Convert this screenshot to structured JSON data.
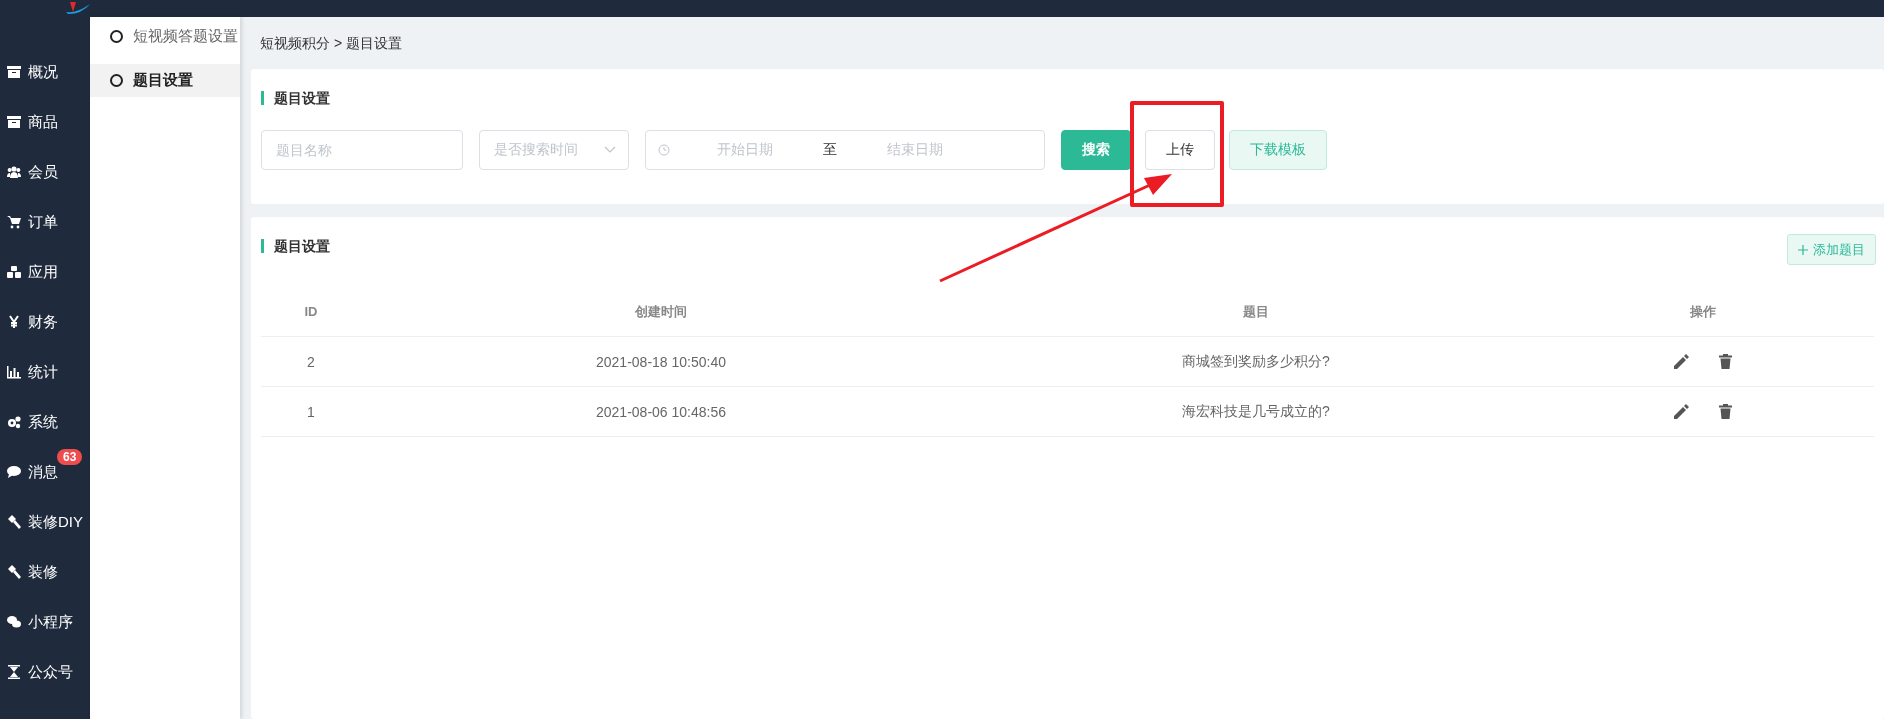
{
  "sidebar": {
    "items": [
      {
        "label": "概况"
      },
      {
        "label": "商品"
      },
      {
        "label": "会员"
      },
      {
        "label": "订单"
      },
      {
        "label": "应用"
      },
      {
        "label": "财务"
      },
      {
        "label": "统计"
      },
      {
        "label": "系统"
      },
      {
        "label": "消息",
        "badge": "63"
      },
      {
        "label": "装修DIY"
      },
      {
        "label": "装修"
      },
      {
        "label": "小程序"
      },
      {
        "label": "公众号"
      }
    ]
  },
  "submenu": {
    "items": [
      {
        "label": "短视频答题设置",
        "selected": false
      },
      {
        "label": "题目设置",
        "selected": true
      }
    ]
  },
  "breadcrumb": "短视频积分 > 题目设置",
  "filter_card": {
    "title": "题目设置",
    "name_field": {
      "placeholder": "题目名称"
    },
    "time_select": {
      "placeholder": "是否搜索时间"
    },
    "date_range": {
      "start_placeholder": "开始日期",
      "separator": "至",
      "end_placeholder": "结束日期"
    },
    "buttons": [
      {
        "label": "搜索",
        "kind": "primary"
      },
      {
        "label": "上传",
        "kind": "default"
      },
      {
        "label": "下载模板",
        "kind": "light"
      }
    ]
  },
  "table_card": {
    "title": "题目设置",
    "add_button": "添加题目",
    "columns": [
      "ID",
      "创建时间",
      "题目",
      "操作"
    ],
    "rows": [
      {
        "id": "2",
        "created": "2021-08-18 10:50:40",
        "question": "商城签到奖励多少积分?"
      },
      {
        "id": "1",
        "created": "2021-08-06 10:48:56",
        "question": "海宏科技是几号成立的?"
      }
    ]
  }
}
